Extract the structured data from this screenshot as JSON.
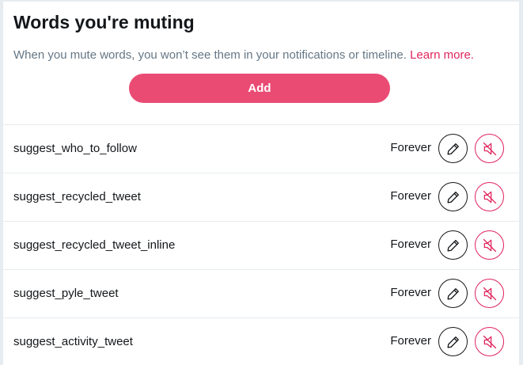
{
  "header": {
    "title": "Words you're muting",
    "subtitle": "When you mute words, you won’t see them in your notifications or timeline.",
    "learn_more": "Learn more."
  },
  "actions": {
    "add_label": "Add"
  },
  "muted_words": [
    {
      "word": "suggest_who_to_follow",
      "duration": "Forever"
    },
    {
      "word": "suggest_recycled_tweet",
      "duration": "Forever"
    },
    {
      "word": "suggest_recycled_tweet_inline",
      "duration": "Forever"
    },
    {
      "word": "suggest_pyle_tweet",
      "duration": "Forever"
    },
    {
      "word": "suggest_activity_tweet",
      "duration": "Forever"
    }
  ],
  "icons": {
    "edit": "pencil-icon",
    "unmute": "unmute-icon"
  },
  "colors": {
    "accent": "#e0245e",
    "add_button": "#ea4b73",
    "text": "#14171a",
    "muted_text": "#657786"
  }
}
